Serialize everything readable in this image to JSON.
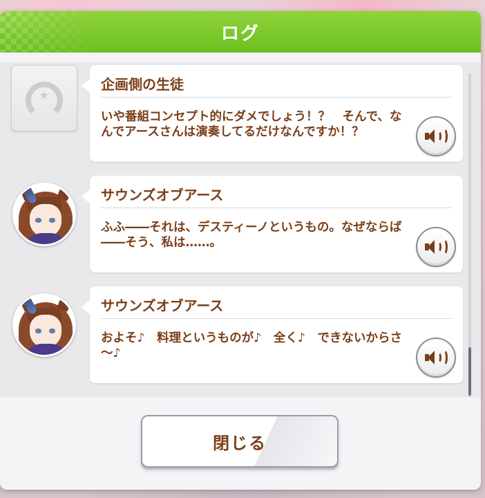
{
  "dialog": {
    "title": "ログ",
    "close_label": "閉じる"
  },
  "log": {
    "entries": [
      {
        "speaker": "企画側の生徒",
        "text": "いや番組コンセプト的にダメでしょう！？　そんで、なんでアースさんは演奏してるだけなんですか！？",
        "avatar": "placeholder-horseshoe-icon",
        "voice_icon": "speaker-icon"
      },
      {
        "speaker": "サウンズオブアース",
        "text": "ふふ――それは、デスティーノというもの。なぜならば――そう、私は……。",
        "avatar": "character-portrait",
        "voice_icon": "speaker-icon"
      },
      {
        "speaker": "サウンズオブアース",
        "text": "およそ♪　料理というものが♪　全く♪　できないからさ～♪",
        "avatar": "character-portrait",
        "voice_icon": "speaker-icon"
      }
    ]
  },
  "colors": {
    "header_green": "#7ccb2c",
    "text_brown": "#7b3f18",
    "panel_bg": "#f4f4f6"
  }
}
